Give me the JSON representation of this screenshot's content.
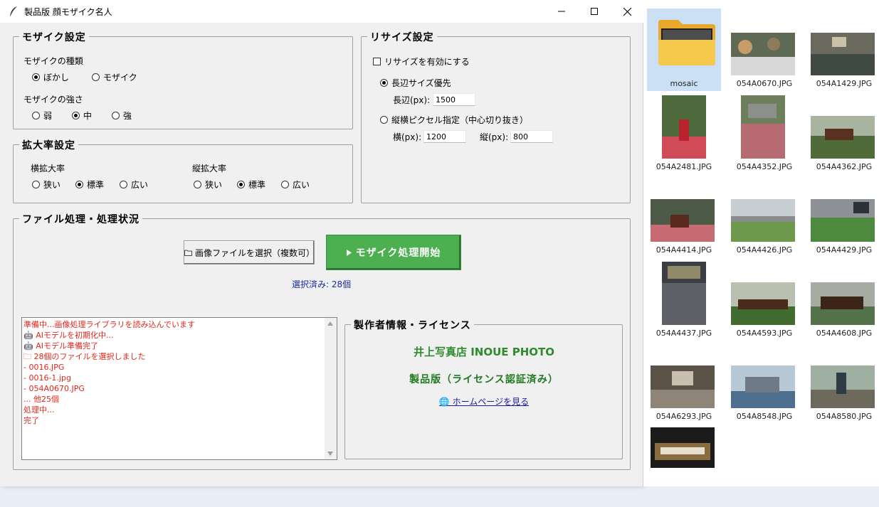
{
  "window": {
    "title": "製品版 顔モザイク名人",
    "controls": [
      "minimize",
      "maximize",
      "close"
    ]
  },
  "mosaic_settings": {
    "legend": "モザイク設定",
    "type_label": "モザイクの種類",
    "type_options": [
      "ぼかし",
      "モザイク"
    ],
    "type_selected": "ぼかし",
    "strength_label": "モザイクの強さ",
    "strength_options": [
      "弱",
      "中",
      "強"
    ],
    "strength_selected": "中"
  },
  "zoom_settings": {
    "legend": "拡大率設定",
    "horizontal_label": "横拡大率",
    "vertical_label": "縦拡大率",
    "options": [
      "狭い",
      "標準",
      "広い"
    ],
    "horizontal_selected": "標準",
    "vertical_selected": "標準"
  },
  "resize_settings": {
    "legend": "リサイズ設定",
    "enable_label": "リサイズを有効にする",
    "enable_checked": false,
    "long_side_option": "長辺サイズ優先",
    "long_side_label": "長辺(px):",
    "long_side_value": "1500",
    "pixel_option": "縦横ピクセル指定（中心切り抜き）",
    "width_label": "横(px):",
    "width_value": "1200",
    "height_label": "縦(px):",
    "height_value": "800",
    "mode_selected": "長辺サイズ優先"
  },
  "processing": {
    "legend": "ファイル処理・処理状況",
    "select_button": "画像ファイルを選択（複数可）",
    "start_button": "モザイク処理開始",
    "selected_count": "選択済み: 28個",
    "log": [
      "準備中...画像処理ライブラリを読み込んでいます",
      "🤖 AIモデルを初期化中...",
      "🤖 AIモデル準備完了",
      "🗀 28個のファイルを選択しました",
      "  - 0016.JPG",
      "  - 0016-1.jpg",
      "  - 054A0670.JPG",
      "  ... 他25個",
      "処理中...",
      "完了"
    ]
  },
  "creator": {
    "legend": "製作者情報・ライセンス",
    "name": "井上写真店 INOUE PHOTO",
    "license": "製品版（ライセンス認証済み）",
    "homepage_link": "🌐 ホームページを見る"
  },
  "explorer": {
    "items": [
      {
        "name": "mosaic",
        "kind": "folder",
        "selected": true
      },
      {
        "name": "054A0670.JPG",
        "kind": "image"
      },
      {
        "name": "054A1429.JPG",
        "kind": "image"
      },
      {
        "name": "054A2481.JPG",
        "kind": "image"
      },
      {
        "name": "054A4352.JPG",
        "kind": "image"
      },
      {
        "name": "054A4362.JPG",
        "kind": "image"
      },
      {
        "name": "054A4414.JPG",
        "kind": "image"
      },
      {
        "name": "054A4426.JPG",
        "kind": "image"
      },
      {
        "name": "054A4429.JPG",
        "kind": "image"
      },
      {
        "name": "054A4437.JPG",
        "kind": "image"
      },
      {
        "name": "054A4593.JPG",
        "kind": "image"
      },
      {
        "name": "054A4608.JPG",
        "kind": "image"
      },
      {
        "name": "054A6293.JPG",
        "kind": "image"
      },
      {
        "name": "054A8548.JPG",
        "kind": "image"
      },
      {
        "name": "054A8580.JPG",
        "kind": "image"
      },
      {
        "name": "",
        "kind": "image"
      }
    ]
  },
  "colors": {
    "start_button": "#4caf50",
    "log_text": "#e0281c",
    "creator_text": "#2e8b2e",
    "selection": "#cce0f5"
  }
}
